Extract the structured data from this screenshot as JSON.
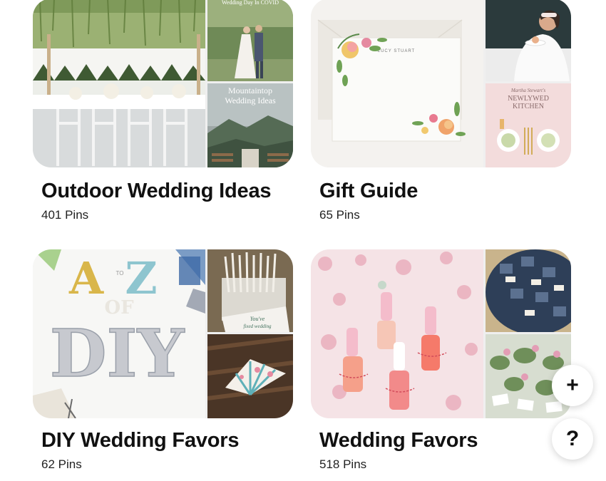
{
  "boards": [
    {
      "title": "Outdoor Wedding Ideas",
      "count": "401 Pins",
      "images": {
        "small_top_caption": "Wedding Day In COVID",
        "small_bottom_caption_line1": "Mountaintop",
        "small_bottom_caption_line2": "Wedding Ideas"
      }
    },
    {
      "title": "Gift Guide",
      "count": "65 Pins",
      "images": {
        "card_text": "LUCY STUART",
        "book_author": "Martha Stewart's",
        "book_title_line1": "NEWLYWED",
        "book_title_line2": "KITCHEN"
      }
    },
    {
      "title": "DIY Wedding Favors",
      "count": "62 Pins",
      "images": {
        "letters_a": "A",
        "letters_to": "TO",
        "letters_z": "Z",
        "letters_of": "OF",
        "letters_diy": "DIY",
        "tag_line1": "You've",
        "tag_line2": "fixed wedding"
      }
    },
    {
      "title": "Wedding Favors",
      "count": "518 Pins",
      "images": {}
    }
  ],
  "fab": {
    "add_glyph": "+",
    "help_glyph": "?"
  },
  "colors": {
    "background": "#ffffff",
    "title": "#111111",
    "fab_background": "#ffffff"
  }
}
